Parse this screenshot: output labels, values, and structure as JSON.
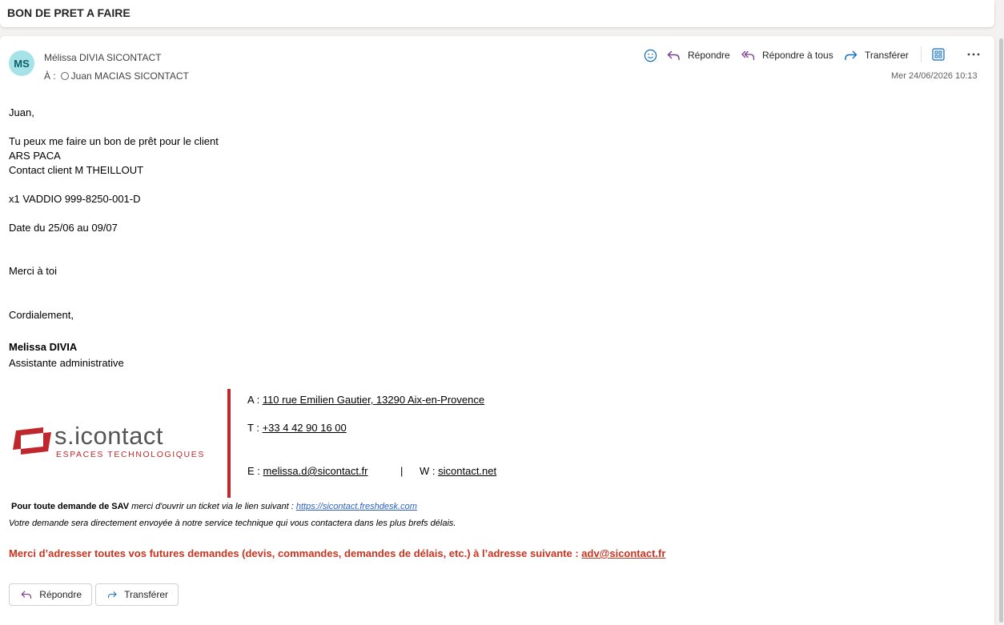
{
  "subject": "BON DE PRET A FAIRE",
  "header": {
    "avatar_initials": "MS",
    "sender": "Mélissa DIVIA SICONTACT",
    "to_label": "À :",
    "recipient": "Juan MACIAS SICONTACT",
    "date": "Mer 24/06/2026 10:13"
  },
  "actions": {
    "reply": "Répondre",
    "reply_all": "Répondre à tous",
    "forward": "Transférer"
  },
  "body": {
    "greeting": "Juan,",
    "line1": "Tu peux me faire un bon de prêt pour le client",
    "line2": "ARS PACA",
    "line3": "Contact client M THEILLOUT",
    "item": "x1 VADDIO 999-8250-001-D",
    "date_range": "Date du 25/06 au 09/07",
    "thanks": "Merci à toi",
    "closing": "Cordialement,"
  },
  "signature": {
    "name": "Melissa DIVIA",
    "title": "Assistante administrative",
    "logo_main": "s.icontact",
    "logo_sub": "ESPACES TECHNOLOGIQUES",
    "address_label": "A :",
    "address": "110 rue Emilien Gautier, 13290 Aix-en-Provence",
    "phone_label": "T :",
    "phone": "+33 4 42 90 16 00",
    "email_label": "E :",
    "email": "melissa.d@sicontact.fr",
    "separator": "|",
    "web_label": "W :",
    "web": "sicontact.net"
  },
  "sav": {
    "bold": "Pour toute demande de SAV",
    "text": " merci d'ouvrir un ticket via le lien suivant : ",
    "link": "https://sicontact.freshdesk.com",
    "line2": "Votre demande sera directement envoyée à notre service technique qui vous contactera dans les plus brefs délais."
  },
  "notice": {
    "text": "Merci d’adresser toutes vos futures demandes (devis, commandes, demandes de délais, etc.) à l’adresse suivante : ",
    "email": "adv@sicontact.fr"
  },
  "footer": {
    "reply": "Répondre",
    "forward": "Transférer"
  },
  "colors": {
    "brand_red": "#c0272d",
    "notice_red": "#c9341f",
    "avatar_bg": "#a6e3e9",
    "reply_icon": "#7a3b8f",
    "forward_icon": "#0f6cbd"
  }
}
